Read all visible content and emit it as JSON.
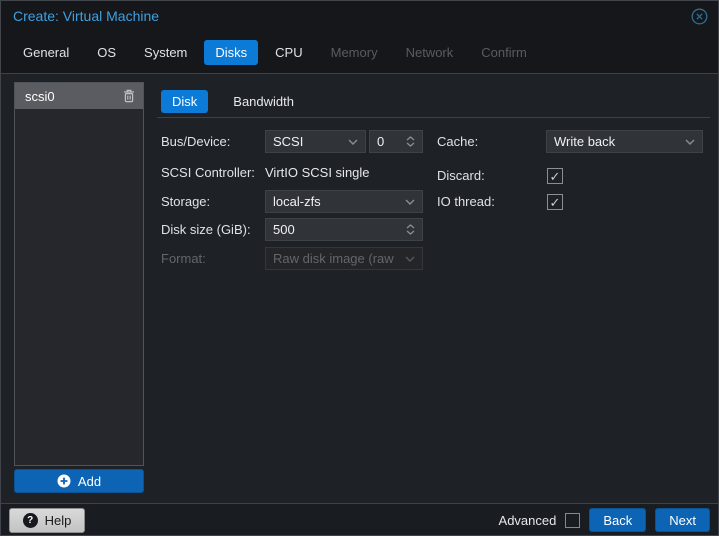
{
  "window": {
    "title": "Create: Virtual Machine"
  },
  "tabs": [
    {
      "label": "General",
      "state": "normal"
    },
    {
      "label": "OS",
      "state": "normal"
    },
    {
      "label": "System",
      "state": "normal"
    },
    {
      "label": "Disks",
      "state": "active"
    },
    {
      "label": "CPU",
      "state": "normal"
    },
    {
      "label": "Memory",
      "state": "disabled"
    },
    {
      "label": "Network",
      "state": "disabled"
    },
    {
      "label": "Confirm",
      "state": "disabled"
    }
  ],
  "sidebar": {
    "items": [
      {
        "label": "scsi0",
        "selected": true
      }
    ],
    "add_button": {
      "label": "Add"
    }
  },
  "subtabs": [
    {
      "label": "Disk",
      "state": "active"
    },
    {
      "label": "Bandwidth",
      "state": "normal"
    }
  ],
  "form": {
    "bus_device": {
      "label": "Bus/Device:",
      "combo_value": "SCSI",
      "spinner_value": "0"
    },
    "scsi_controller": {
      "label": "SCSI Controller:",
      "value": "VirtIO SCSI single"
    },
    "storage": {
      "label": "Storage:",
      "value": "local-zfs"
    },
    "disk_size": {
      "label": "Disk size (GiB):",
      "value": "500"
    },
    "format": {
      "label": "Format:",
      "value": "Raw disk image (raw",
      "disabled": true
    },
    "cache": {
      "label": "Cache:",
      "value": "Write back"
    },
    "discard": {
      "label": "Discard:",
      "checked": true
    },
    "io_thread": {
      "label": "IO thread:",
      "checked": true
    }
  },
  "footer": {
    "help_label": "Help",
    "advanced_label": "Advanced",
    "advanced_checked": false,
    "back_label": "Back",
    "next_label": "Next"
  },
  "icons": {
    "close": "circled-x",
    "trash": "trash-can",
    "add": "plus-circle",
    "help": "question-circle",
    "combo": "chevron-down",
    "spinner": "chevrons-up-down",
    "check": "✓",
    "question_mark": "?"
  },
  "colors": {
    "accent_blue": "#0c7bd8",
    "button_blue": "#0d64b4",
    "title_blue": "#3f9fe0",
    "panel_dark": "#15171a",
    "content_bg": "#1e2126",
    "selected_row": "#5a5c61"
  }
}
